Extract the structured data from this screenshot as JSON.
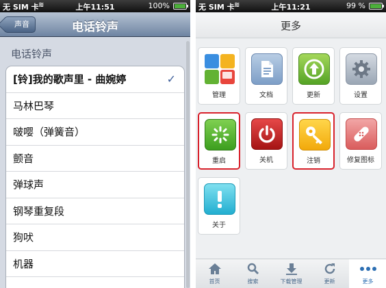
{
  "left_screen": {
    "status": {
      "carrier": "无 SIM 卡",
      "time": "上午11:51",
      "battery": "100%",
      "battery_level": 1.0
    },
    "nav": {
      "back_label": "声音",
      "title": "电话铃声"
    },
    "section_label": "电话铃声",
    "ringtones": [
      {
        "label": "[铃]我的歌声里 - 曲婉婷",
        "selected": true
      },
      {
        "label": "马林巴琴"
      },
      {
        "label": "啵嘤（弹簧音）"
      },
      {
        "label": "颤音"
      },
      {
        "label": "弹球声"
      },
      {
        "label": "钢琴重复段"
      },
      {
        "label": "狗吠"
      },
      {
        "label": "机器"
      }
    ],
    "check_mark": "✓"
  },
  "right_screen": {
    "status": {
      "carrier": "无 SIM 卡",
      "time": "上午11:21",
      "battery": "99 %",
      "battery_level": 0.99
    },
    "nav": {
      "title": "更多"
    },
    "tiles": [
      {
        "label": "管理",
        "icon": "manage-icon"
      },
      {
        "label": "文档",
        "icon": "document-icon"
      },
      {
        "label": "更新",
        "icon": "update-arrow-icon"
      },
      {
        "label": "设置",
        "icon": "gear-icon"
      },
      {
        "label": "重启",
        "icon": "restart-icon",
        "highlighted": true
      },
      {
        "label": "关机",
        "icon": "power-icon"
      },
      {
        "label": "注销",
        "icon": "key-icon",
        "highlighted": true
      },
      {
        "label": "修复图标",
        "icon": "bandage-icon"
      },
      {
        "label": "关于",
        "icon": "exclamation-icon"
      }
    ],
    "tabs": [
      {
        "label": "首页",
        "icon": "home-icon"
      },
      {
        "label": "搜索",
        "icon": "search-icon"
      },
      {
        "label": "下载管理",
        "icon": "download-icon"
      },
      {
        "label": "更新",
        "icon": "refresh-icon"
      },
      {
        "label": "更多",
        "icon": "more-dots-icon",
        "active": true
      }
    ],
    "colors": {
      "highlight_border": "#d8202a",
      "active_tab": "#2d6fb3"
    }
  }
}
